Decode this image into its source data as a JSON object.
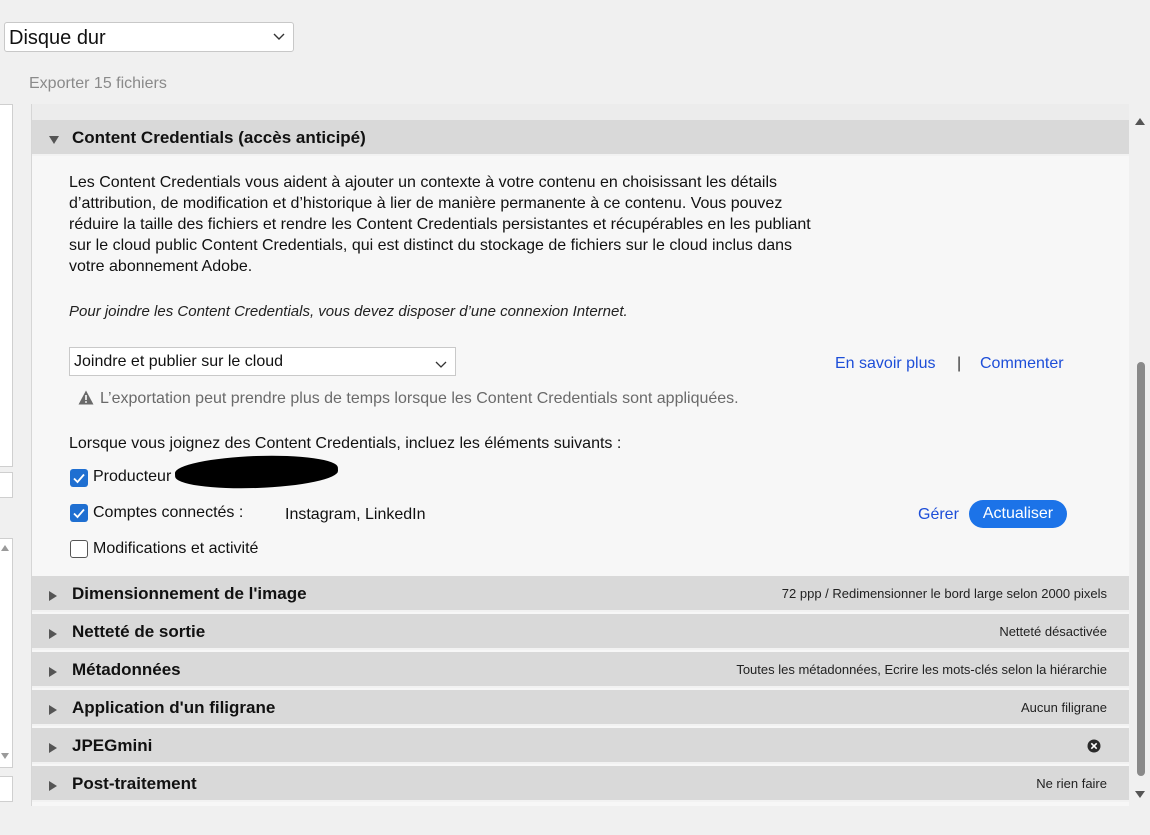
{
  "destination": {
    "value": "Disque dur"
  },
  "export_count": "Exporter 15 fichiers",
  "content_credentials": {
    "title": "Content Credentials (accès anticipé)",
    "description_lines": [
      "Les Content Credentials vous aident à ajouter un contexte à votre contenu en choisissant les détails",
      "d’attribution, de modification et d’historique à lier de manière permanente à ce contenu. Vous pouvez",
      "réduire la taille des fichiers et rendre les Content Credentials persistantes et récupérables en les publiant",
      "sur le cloud public Content Credentials, qui est distinct du stockage de fichiers sur le cloud inclus dans",
      "votre abonnement Adobe."
    ],
    "note": "Pour joindre les Content Credentials, vous devez disposer d’une connexion Internet.",
    "mode_select": "Joindre et publier sur le cloud",
    "learn_more": "En savoir plus",
    "separator": "|",
    "comment": "Commenter",
    "warning": "L’exportation peut prendre plus de temps lorsque les Content Credentials sont appliquées.",
    "include_label": "Lorsque vous joignez des Content Credentials, incluez les éléments suivants :",
    "options": [
      {
        "label": "Producteur",
        "checked": true
      },
      {
        "label": "Comptes connectés :",
        "checked": true,
        "value": "Instagram, LinkedIn"
      },
      {
        "label": "Modifications et activité",
        "checked": false
      }
    ],
    "manage": "Gérer",
    "refresh": "Actualiser"
  },
  "sections": [
    {
      "title": "Dimensionnement de l'image",
      "summary": "72 ppp / Redimensionner le bord large selon 2000 pixels"
    },
    {
      "title": "Netteté de sortie",
      "summary": "Netteté désactivée"
    },
    {
      "title": "Métadonnées",
      "summary": "Toutes les métadonnées, Ecrire les mots-clés selon la hiérarchie"
    },
    {
      "title": "Application d'un filigrane",
      "summary": "Aucun filigrane"
    },
    {
      "title": "JPEGmini",
      "summary": ""
    },
    {
      "title": "Post-traitement",
      "summary": "Ne rien faire"
    }
  ],
  "colors": {
    "accent": "#1c73e8",
    "link": "#1d4ed8",
    "header_bg": "#d9d9d9"
  }
}
